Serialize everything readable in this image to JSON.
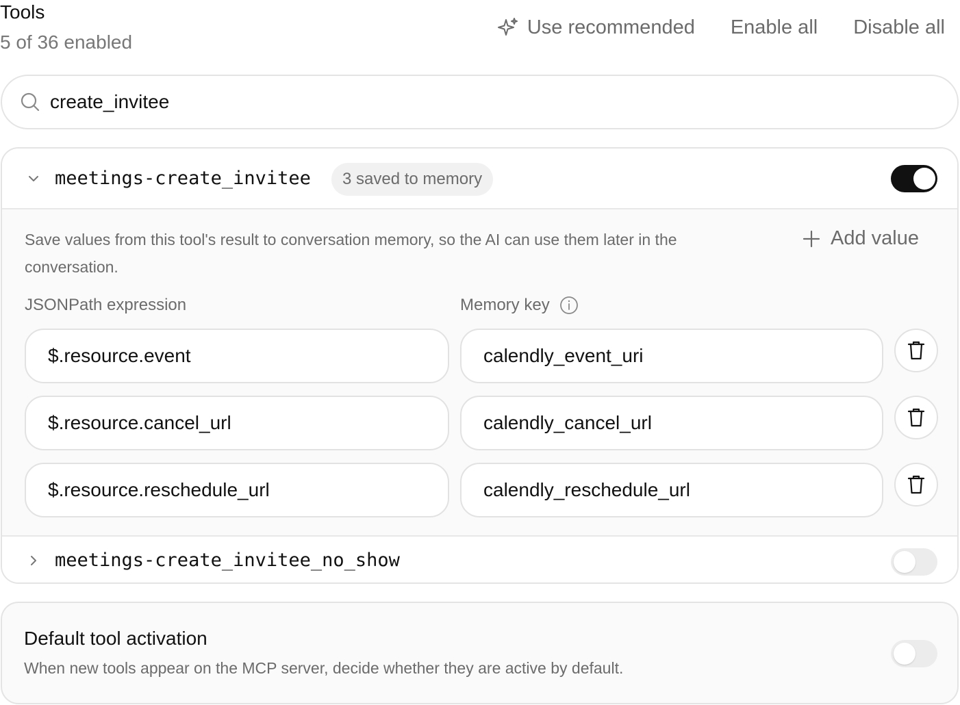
{
  "header": {
    "title": "Tools",
    "subtitle": "5 of 36 enabled",
    "use_recommended": "Use recommended",
    "enable_all": "Enable all",
    "disable_all": "Disable all"
  },
  "search": {
    "value": "create_invitee",
    "icon": "search-icon"
  },
  "tools": [
    {
      "name": "meetings-create_invitee",
      "badge": "3 saved to memory",
      "expanded": true,
      "enabled": true,
      "description": "Save values from this tool's result to conversation memory, so the AI can use them later in the conversation.",
      "add_value_label": "Add value",
      "jsonpath_label": "JSONPath expression",
      "memory_key_label": "Memory key",
      "mappings": [
        {
          "path": "$.resource.event",
          "key": "calendly_event_uri"
        },
        {
          "path": "$.resource.cancel_url",
          "key": "calendly_cancel_url"
        },
        {
          "path": "$.resource.reschedule_url",
          "key": "calendly_reschedule_url"
        }
      ]
    },
    {
      "name": "meetings-create_invitee_no_show",
      "expanded": false,
      "enabled": false
    }
  ],
  "default_activation": {
    "title": "Default tool activation",
    "description": "When new tools appear on the MCP server, decide whether they are active by default.",
    "enabled": false
  },
  "colors": {
    "toggle_on": "#111111",
    "toggle_off": "#ececec",
    "muted_text": "#6b6b6b",
    "border": "#e4e4e4"
  }
}
